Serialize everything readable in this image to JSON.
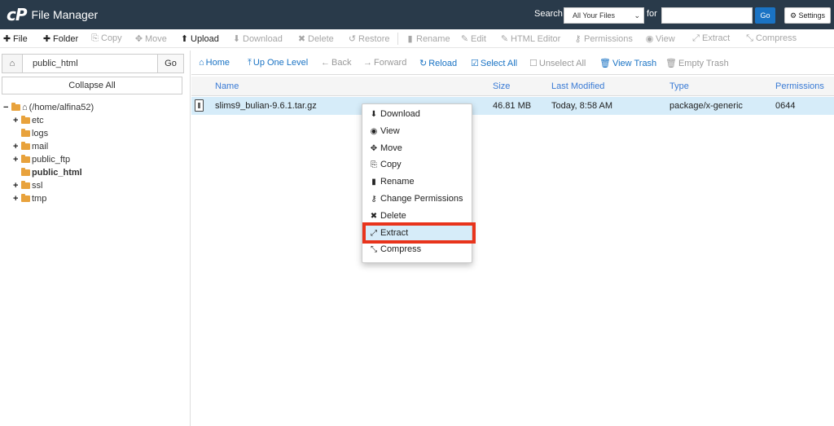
{
  "header": {
    "logo_mark": "cP",
    "app_title": "File Manager",
    "search_label": "Search",
    "search_scope": "All Your Files",
    "for_label": "for",
    "search_value": "",
    "go_label": "Go",
    "settings_label": "Settings"
  },
  "toolbar": {
    "items": [
      {
        "label": "File",
        "icon": "plus-icon",
        "glyph": "✚",
        "state": "active"
      },
      {
        "label": "Folder",
        "icon": "plus-icon",
        "glyph": "✚",
        "state": "active"
      },
      {
        "label": "Copy",
        "icon": "copy-icon",
        "glyph": "⎘",
        "state": "disabled"
      },
      {
        "label": "Move",
        "icon": "move-icon",
        "glyph": "✥",
        "state": "disabled"
      },
      {
        "label": "Upload",
        "icon": "upload-icon",
        "glyph": "⬆",
        "state": "active"
      },
      {
        "label": "Download",
        "icon": "download-icon",
        "glyph": "⬇",
        "state": "disabled"
      },
      {
        "label": "Delete",
        "icon": "delete-icon",
        "glyph": "✖",
        "state": "disabled"
      },
      {
        "label": "Restore",
        "icon": "restore-icon",
        "glyph": "↺",
        "state": "disabled"
      },
      {
        "label": "Rename",
        "icon": "rename-icon",
        "glyph": "▮",
        "state": "disabled"
      },
      {
        "label": "Edit",
        "icon": "edit-icon",
        "glyph": "✎",
        "state": "disabled"
      },
      {
        "label": "HTML Editor",
        "icon": "html-editor-icon",
        "glyph": "✎",
        "state": "disabled"
      },
      {
        "label": "Permissions",
        "icon": "key-icon",
        "glyph": "⚷",
        "state": "disabled"
      },
      {
        "label": "View",
        "icon": "eye-icon",
        "glyph": "◉",
        "state": "disabled"
      },
      {
        "label": "Extract",
        "icon": "extract-icon",
        "glyph": "⤢",
        "state": "disabled"
      },
      {
        "label": "Compress",
        "icon": "compress-icon",
        "glyph": "⤡",
        "state": "disabled"
      }
    ]
  },
  "left": {
    "home_glyph": "⌂",
    "path_value": "public_html",
    "go_label": "Go",
    "collapse_label": "Collapse All",
    "tree": [
      {
        "toggle": "−",
        "label": "(/home/alfina52)",
        "bold": false,
        "home": true
      },
      {
        "toggle": "+",
        "label": "etc",
        "bold": false
      },
      {
        "toggle": "",
        "label": "logs",
        "bold": false
      },
      {
        "toggle": "+",
        "label": "mail",
        "bold": false
      },
      {
        "toggle": "+",
        "label": "public_ftp",
        "bold": false
      },
      {
        "toggle": "",
        "label": "public_html",
        "bold": true
      },
      {
        "toggle": "+",
        "label": "ssl",
        "bold": false
      },
      {
        "toggle": "+",
        "label": "tmp",
        "bold": false
      }
    ]
  },
  "main_toolbar": {
    "home": "Home",
    "up": "Up One Level",
    "back": "Back",
    "forward": "Forward",
    "reload": "Reload",
    "select_all": "Select All",
    "unselect_all": "Unselect All",
    "view_trash": "View Trash",
    "empty_trash": "Empty Trash"
  },
  "table": {
    "headers": {
      "name": "Name",
      "size": "Size",
      "modified": "Last Modified",
      "type": "Type",
      "perms": "Permissions"
    },
    "rows": [
      {
        "name": "slims9_bulian-9.6.1.tar.gz",
        "size": "46.81 MB",
        "modified": "Today, 8:58 AM",
        "type": "package/x-generic",
        "perms": "0644"
      }
    ]
  },
  "context_menu": {
    "items": [
      {
        "label": "Download",
        "icon": "download-icon",
        "glyph": "⬇"
      },
      {
        "label": "View",
        "icon": "eye-icon",
        "glyph": "◉"
      },
      {
        "label": "Move",
        "icon": "move-icon",
        "glyph": "✥"
      },
      {
        "label": "Copy",
        "icon": "copy-icon",
        "glyph": "⎘"
      },
      {
        "label": "Rename",
        "icon": "rename-icon",
        "glyph": "▮"
      },
      {
        "label": "Change Permissions",
        "icon": "key-icon",
        "glyph": "⚷"
      },
      {
        "label": "Delete",
        "icon": "delete-icon",
        "glyph": "✖"
      },
      {
        "label": "Extract",
        "icon": "extract-icon",
        "glyph": "⤢",
        "highlighted": true
      },
      {
        "label": "Compress",
        "icon": "compress-icon",
        "glyph": "⤡"
      }
    ]
  },
  "colors": {
    "header_bg": "#293a4a",
    "accent": "#1a73c4",
    "row_selected": "#d6ecf9",
    "highlight_border": "#e8341c"
  }
}
